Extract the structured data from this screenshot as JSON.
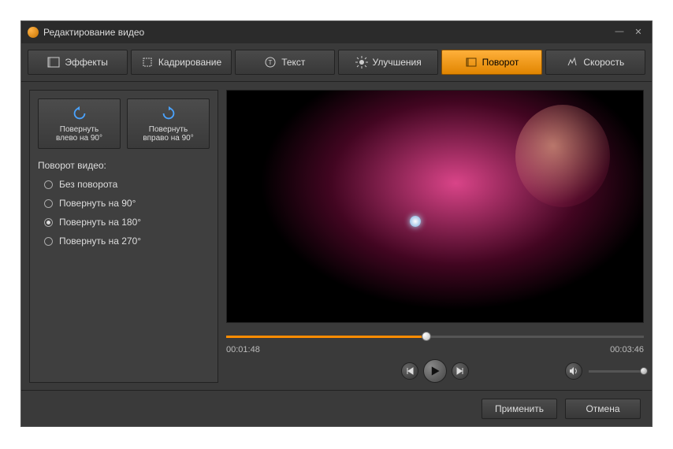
{
  "window": {
    "title": "Редактирование видео"
  },
  "tabs": {
    "effects": "Эффекты",
    "crop": "Кадрирование",
    "text": "Текст",
    "enhance": "Улучшения",
    "rotate": "Поворот",
    "speed": "Скорость",
    "active": "rotate"
  },
  "rotate": {
    "left_line1": "Повернуть",
    "left_line2": "влево  на 90°",
    "right_line1": "Повернуть",
    "right_line2": "вправо на 90°",
    "section_label": "Поворот видео:",
    "options": [
      "Без поворота",
      "Повернуть на 90°",
      "Повернуть на 180°",
      "Повернуть на 270°"
    ],
    "selected_index": 2
  },
  "player": {
    "current_time": "00:01:48",
    "total_time": "00:03:46",
    "progress_percent": 48
  },
  "footer": {
    "apply": "Применить",
    "cancel": "Отмена"
  }
}
